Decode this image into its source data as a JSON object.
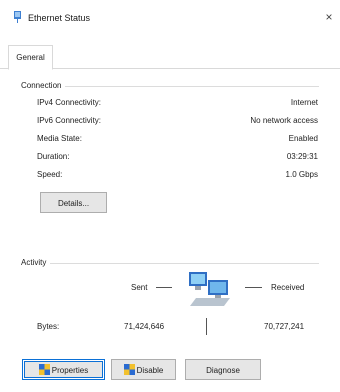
{
  "window": {
    "title": "Ethernet Status",
    "close_glyph": "×"
  },
  "tabs": [
    {
      "label": "General"
    }
  ],
  "connection": {
    "label": "Connection",
    "rows": [
      {
        "label": "IPv4 Connectivity:",
        "value": "Internet"
      },
      {
        "label": "IPv6 Connectivity:",
        "value": "No network access"
      },
      {
        "label": "Media State:",
        "value": "Enabled"
      },
      {
        "label": "Duration:",
        "value": "03:29:31"
      },
      {
        "label": "Speed:",
        "value": "1.0 Gbps"
      }
    ],
    "details_label": "Details..."
  },
  "activity": {
    "label": "Activity",
    "sent_label": "Sent",
    "received_label": "Received",
    "bytes_label": "Bytes:",
    "bytes_sent": "71,424,646",
    "bytes_received": "70,727,241"
  },
  "buttons": {
    "properties": "Properties",
    "disable": "Disable",
    "diagnose": "Diagnose"
  },
  "icons": {
    "title": "network-adapter-icon",
    "network": "network-computers-icon",
    "properties": "shield-icon",
    "disable": "disable-adapter-icon"
  },
  "colors": {
    "accent": "#0b70d6",
    "button_bg": "#e6e6e6",
    "border": "#adadad"
  }
}
